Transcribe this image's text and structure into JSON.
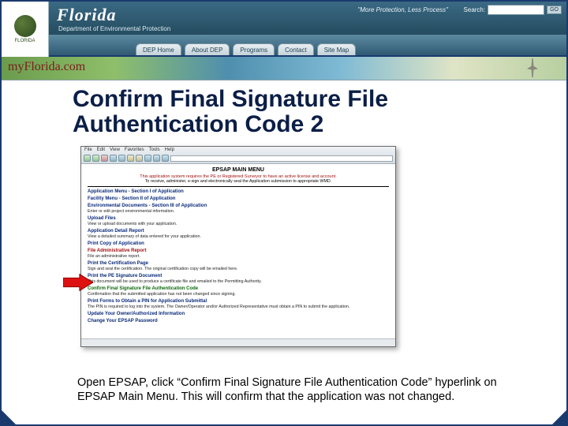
{
  "banner": {
    "logo_label": "FLORIDA",
    "state_title": "Florida",
    "dept_subtitle": "Department of Environmental Protection",
    "tagline": "\"More Protection, Less Process\"",
    "search_label": "Search:",
    "go_label": "GO",
    "myflorida": "myFlorida.com",
    "nav": [
      "DEP Home",
      "About DEP",
      "Programs",
      "Contact",
      "Site Map"
    ]
  },
  "slide": {
    "title": "Confirm Final Signature File Authentication Code 2",
    "caption": "Open EPSAP, click “Confirm Final Signature File Authentication Code” hyperlink on EPSAP Main Menu.  This will confirm that the application was not changed."
  },
  "screenshot": {
    "menus": [
      "File",
      "Edit",
      "View",
      "Favorites",
      "Tools",
      "Help"
    ],
    "page_title": "EPSAP MAIN MENU",
    "notice_red": "This application system requires the PE or Registered Surveyor to have an active license and account.",
    "notice_black": "To receive, administer, e-sign and electronically seal the Application submission to appropriate WMD.",
    "sections": [
      {
        "h": "Application Menu - Section I of Application",
        "d": "",
        "cls": ""
      },
      {
        "h": "Facility Menu - Section II of Application",
        "d": "",
        "cls": ""
      },
      {
        "h": "Environmental Documents - Section III of Application",
        "d": "Enter or edit project environmental information.",
        "cls": ""
      },
      {
        "h": "Upload Files",
        "d": "View or upload documents with your application.",
        "cls": ""
      },
      {
        "h": "Application Detail Report",
        "d": "View a detailed summary of data entered for your application.",
        "cls": ""
      },
      {
        "h": "Print Copy of Application",
        "d": "",
        "cls": ""
      },
      {
        "h": "File Administrative Report",
        "d": "File an administrative report.",
        "cls": "red"
      },
      {
        "h": "Print the Certification Page",
        "d": "Sign and seal the certification. The original certification copy will be emailed here.",
        "cls": ""
      },
      {
        "h": "Print the PE Signature Document",
        "d": "This document will be used to produce a certificate file and emailed to the Permitting Authority.",
        "cls": ""
      },
      {
        "h": "Confirm Final Signature File Authentication Code",
        "d": "Confirmation that the submitted application has not been changed since signing.",
        "cls": "green"
      },
      {
        "h": "Print Forms to Obtain a PIN for Application Submittal",
        "d": "The PIN is required to log into the system.  The Owner/Operator and/or Authorized Representative must obtain a PIN to submit the application.",
        "cls": ""
      },
      {
        "h": "Update Your Owner/Authorized Information",
        "d": "",
        "cls": ""
      },
      {
        "h": "Change Your EPSAP Password",
        "d": "",
        "cls": ""
      }
    ]
  }
}
